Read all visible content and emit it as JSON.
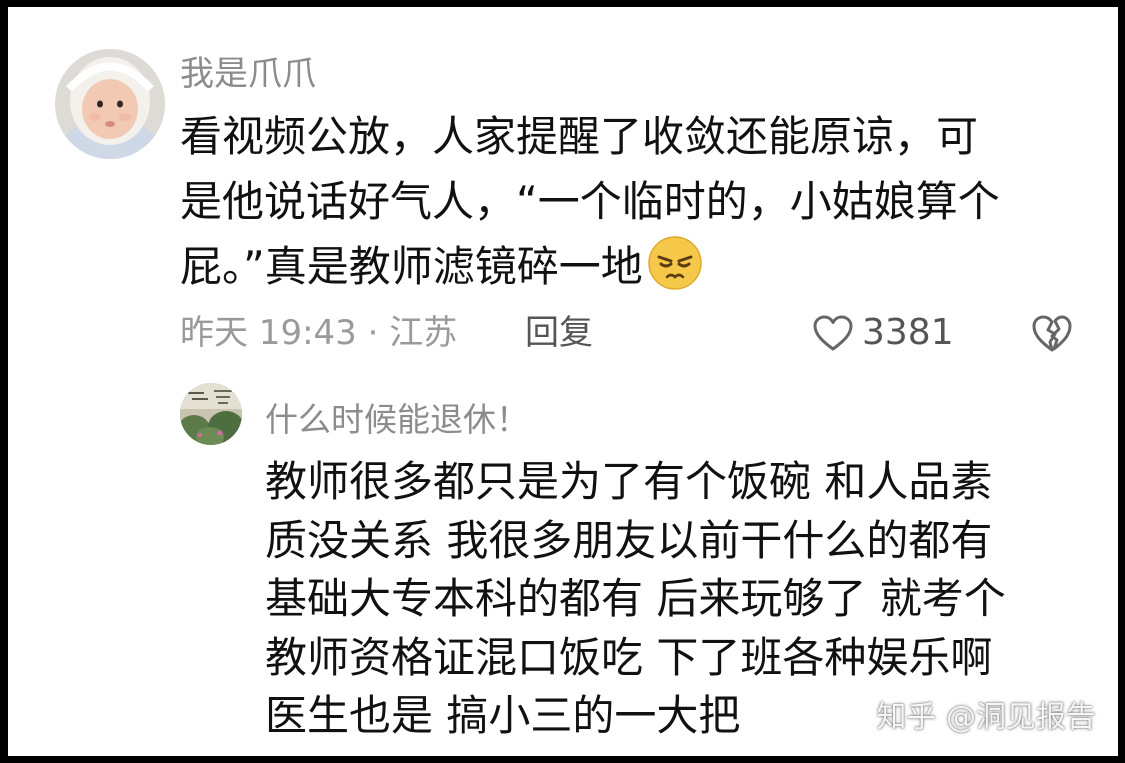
{
  "comment": {
    "avatar_icon": "baby-photo-avatar",
    "username": "我是爪爪",
    "text_lines": [
      "看视频公放，人家提醒了收敛还能原谅，可",
      "是他说话好气人，“一个临时的，小姑娘算个",
      "屁。”真是教师滤镜碎一地"
    ],
    "emoji_icon": "squint-annoyed-emoji",
    "time_location": "昨天 19:43 · 江苏",
    "reply_label": "回复",
    "like_icon": "heart-outline-icon",
    "like_count": "3381",
    "dislike_icon": "broken-heart-icon"
  },
  "reply": {
    "avatar_icon": "plant-photo-avatar",
    "username": "什么时候能退休！",
    "text_lines": [
      "教师很多都只是为了有个饭碗 和人品素",
      "质没关系 我很多朋友以前干什么的都有",
      "基础大专本科的都有 后来玩够了 就考个",
      "教师资格证混口饭吃 下了班各种娱乐啊",
      "医生也是 搞小三的一大把"
    ]
  },
  "watermark": "知乎 @洞见报告",
  "colors": {
    "background_frame": "#000000",
    "card": "#ffffff",
    "text_primary": "#111111",
    "text_secondary": "#8c8c8c",
    "emoji_yellow": "#f6c84a"
  }
}
